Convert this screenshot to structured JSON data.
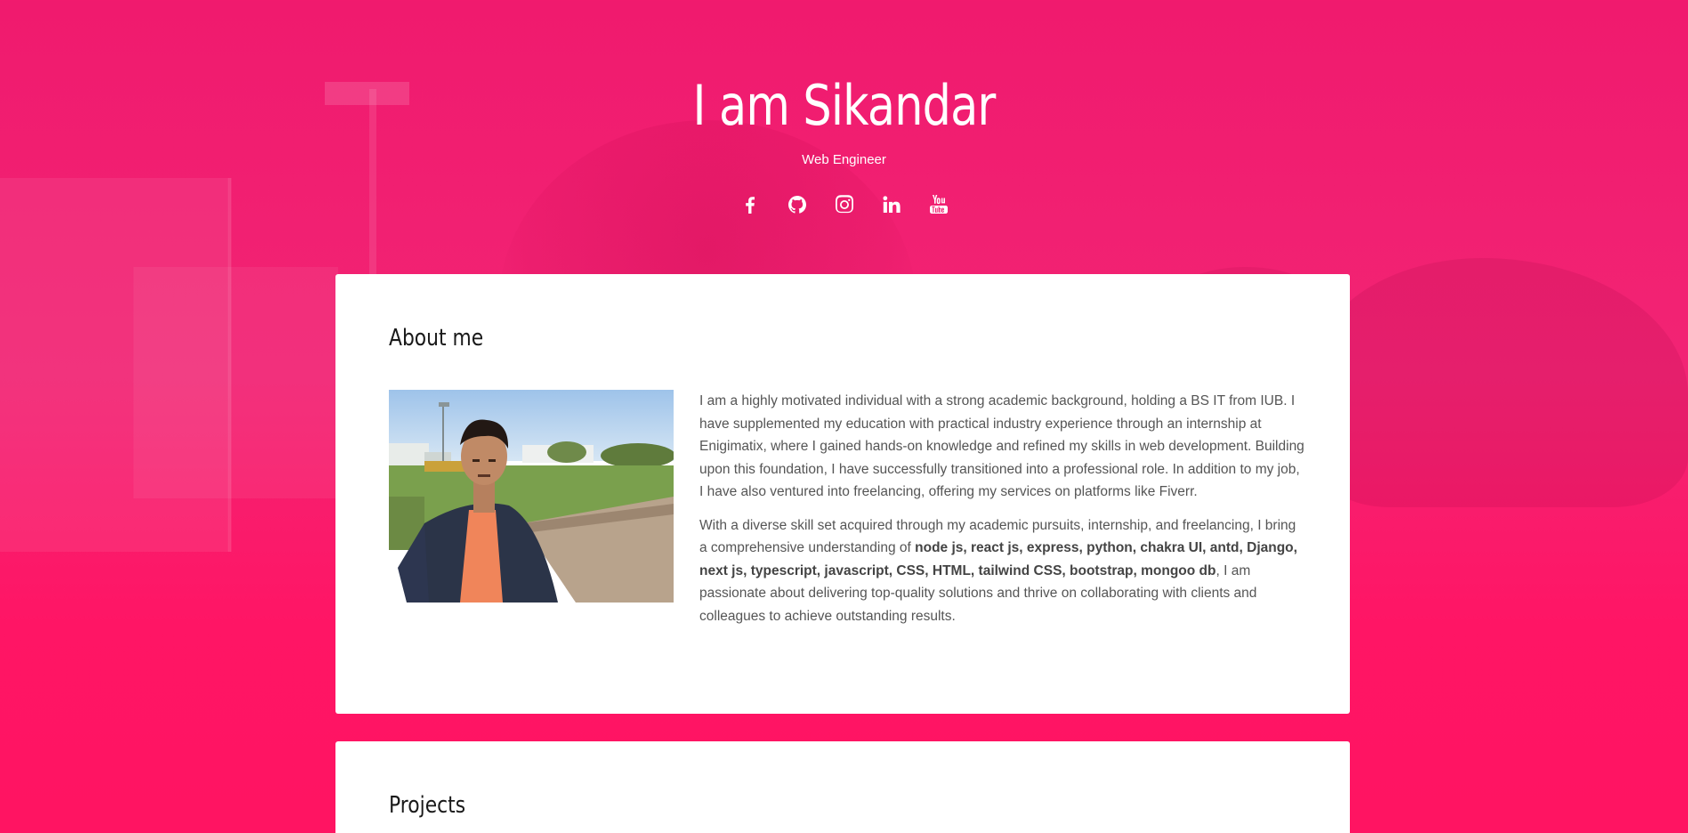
{
  "hero": {
    "title": "I am Sikandar",
    "subtitle": "Web Engineer",
    "social": [
      {
        "name": "facebook",
        "icon": "facebook-icon"
      },
      {
        "name": "github",
        "icon": "github-icon"
      },
      {
        "name": "instagram",
        "icon": "instagram-icon"
      },
      {
        "name": "linkedin",
        "icon": "linkedin-icon"
      },
      {
        "name": "youtube",
        "icon": "youtube-icon"
      }
    ]
  },
  "about": {
    "heading": "About me",
    "paragraph1": "I am a highly motivated individual with a strong academic background, holding a BS IT from IUB. I have supplemented my education with practical industry experience through an internship at Enigimatix, where I gained hands-on knowledge and refined my skills in web development. Building upon this foundation, I have successfully transitioned into a professional role. In addition to my job, I have also ventured into freelancing, offering my services on platforms like Fiverr.",
    "paragraph2_intro": "With a diverse skill set acquired through my academic pursuits, internship, and freelancing, I bring a comprehensive understanding of ",
    "paragraph2_skills": "node js, react js, express, python, chakra UI, antd, Django, next js, typescript, javascript, CSS, HTML, tailwind CSS, bootstrap, mongoo db",
    "paragraph2_outro": ", I am passionate about delivering top-quality solutions and thrive on collaborating with clients and colleagues to achieve outstanding results."
  },
  "projects": {
    "heading": "Projects"
  },
  "colors": {
    "accent": "#f01a6e",
    "card": "#ffffff",
    "text": "#555555"
  }
}
